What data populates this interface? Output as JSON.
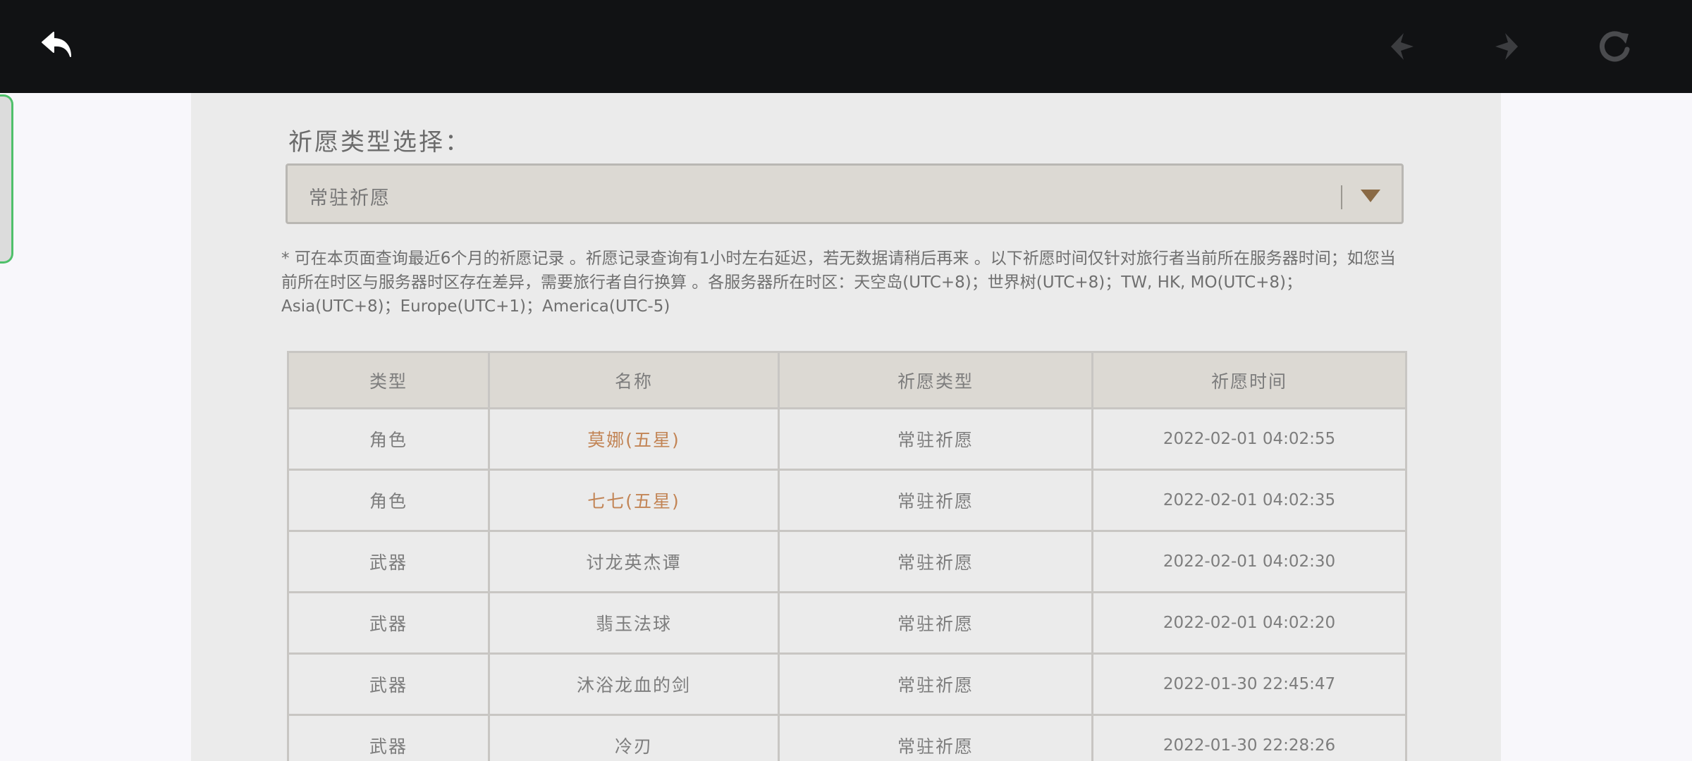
{
  "toolbar": {
    "back_icon": "back-arrow-icon",
    "prev_icon": "nav-prev-icon",
    "next_icon": "nav-next-icon",
    "refresh_icon": "refresh-icon"
  },
  "wish_selector": {
    "label": "祈愿类型选择：",
    "selected": "常驻祈愿"
  },
  "notice": "* 可在本页面查询最近6个月的祈愿记录 。祈愿记录查询有1小时左右延迟，若无数据请稍后再来 。以下祈愿时间仅针对旅行者当前所在服务器时间；如您当前所在时区与服务器时区存在差异，需要旅行者自行换算 。各服务器所在时区：天空岛(UTC+8)；世界树(UTC+8)；TW, HK, MO(UTC+8)；Asia(UTC+8)；Europe(UTC+1)；America(UTC-5)",
  "table": {
    "headers": [
      "类型",
      "名称",
      "祈愿类型",
      "祈愿时间"
    ],
    "rows": [
      {
        "type": "角色",
        "name": "莫娜(五星)",
        "wish": "常驻祈愿",
        "time": "2022-02-01 04:02:55"
      },
      {
        "type": "角色",
        "name": "七七(五星)",
        "wish": "常驻祈愿",
        "time": "2022-02-01 04:02:35"
      },
      {
        "type": "武器",
        "name": "讨龙英杰谭",
        "wish": "常驻祈愿",
        "time": "2022-02-01 04:02:30"
      },
      {
        "type": "武器",
        "name": "翡玉法球",
        "wish": "常驻祈愿",
        "time": "2022-02-01 04:02:20"
      },
      {
        "type": "武器",
        "name": "沐浴龙血的剑",
        "wish": "常驻祈愿",
        "time": "2022-01-30 22:45:47"
      },
      {
        "type": "武器",
        "name": "冷刃",
        "wish": "常驻祈愿",
        "time": "2022-01-30 22:28:26"
      }
    ]
  },
  "colors": {
    "topbar": "#111214",
    "panel": "#ebebeb",
    "header_bg": "#dcd9d3",
    "five_star": "#c28455",
    "side_tab_border": "#4fc06a"
  }
}
